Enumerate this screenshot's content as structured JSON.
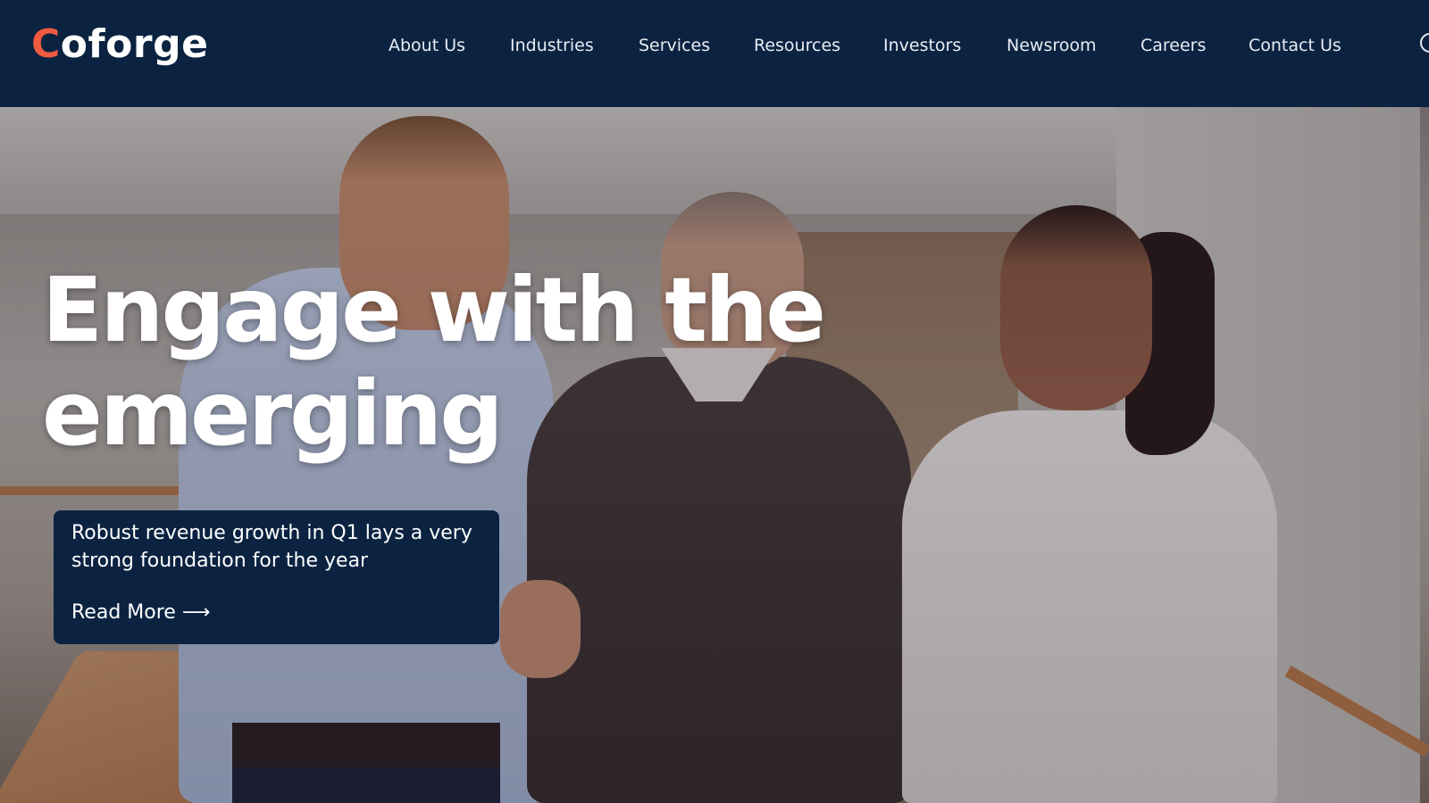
{
  "brand": {
    "logo_accent": "C",
    "logo_rest": "oforge",
    "colors": {
      "navy": "#0b2341",
      "accent": "#f05a40",
      "text": "#ffffff"
    }
  },
  "nav": {
    "items": [
      {
        "label": "About Us"
      },
      {
        "label": "Industries"
      },
      {
        "label": "Services"
      },
      {
        "label": "Resources"
      },
      {
        "label": "Investors"
      },
      {
        "label": "Newsroom"
      },
      {
        "label": "Careers"
      },
      {
        "label": "Contact Us"
      }
    ],
    "search_icon": "search-icon"
  },
  "hero": {
    "title": "Engage with the emerging",
    "image_description": "Three business professionals shaking hands in an office atrium"
  },
  "news_card": {
    "text": "Robust revenue growth in Q1 lays a very strong foundation for the year",
    "link_label": "Read More",
    "link_arrow": "⟶"
  }
}
